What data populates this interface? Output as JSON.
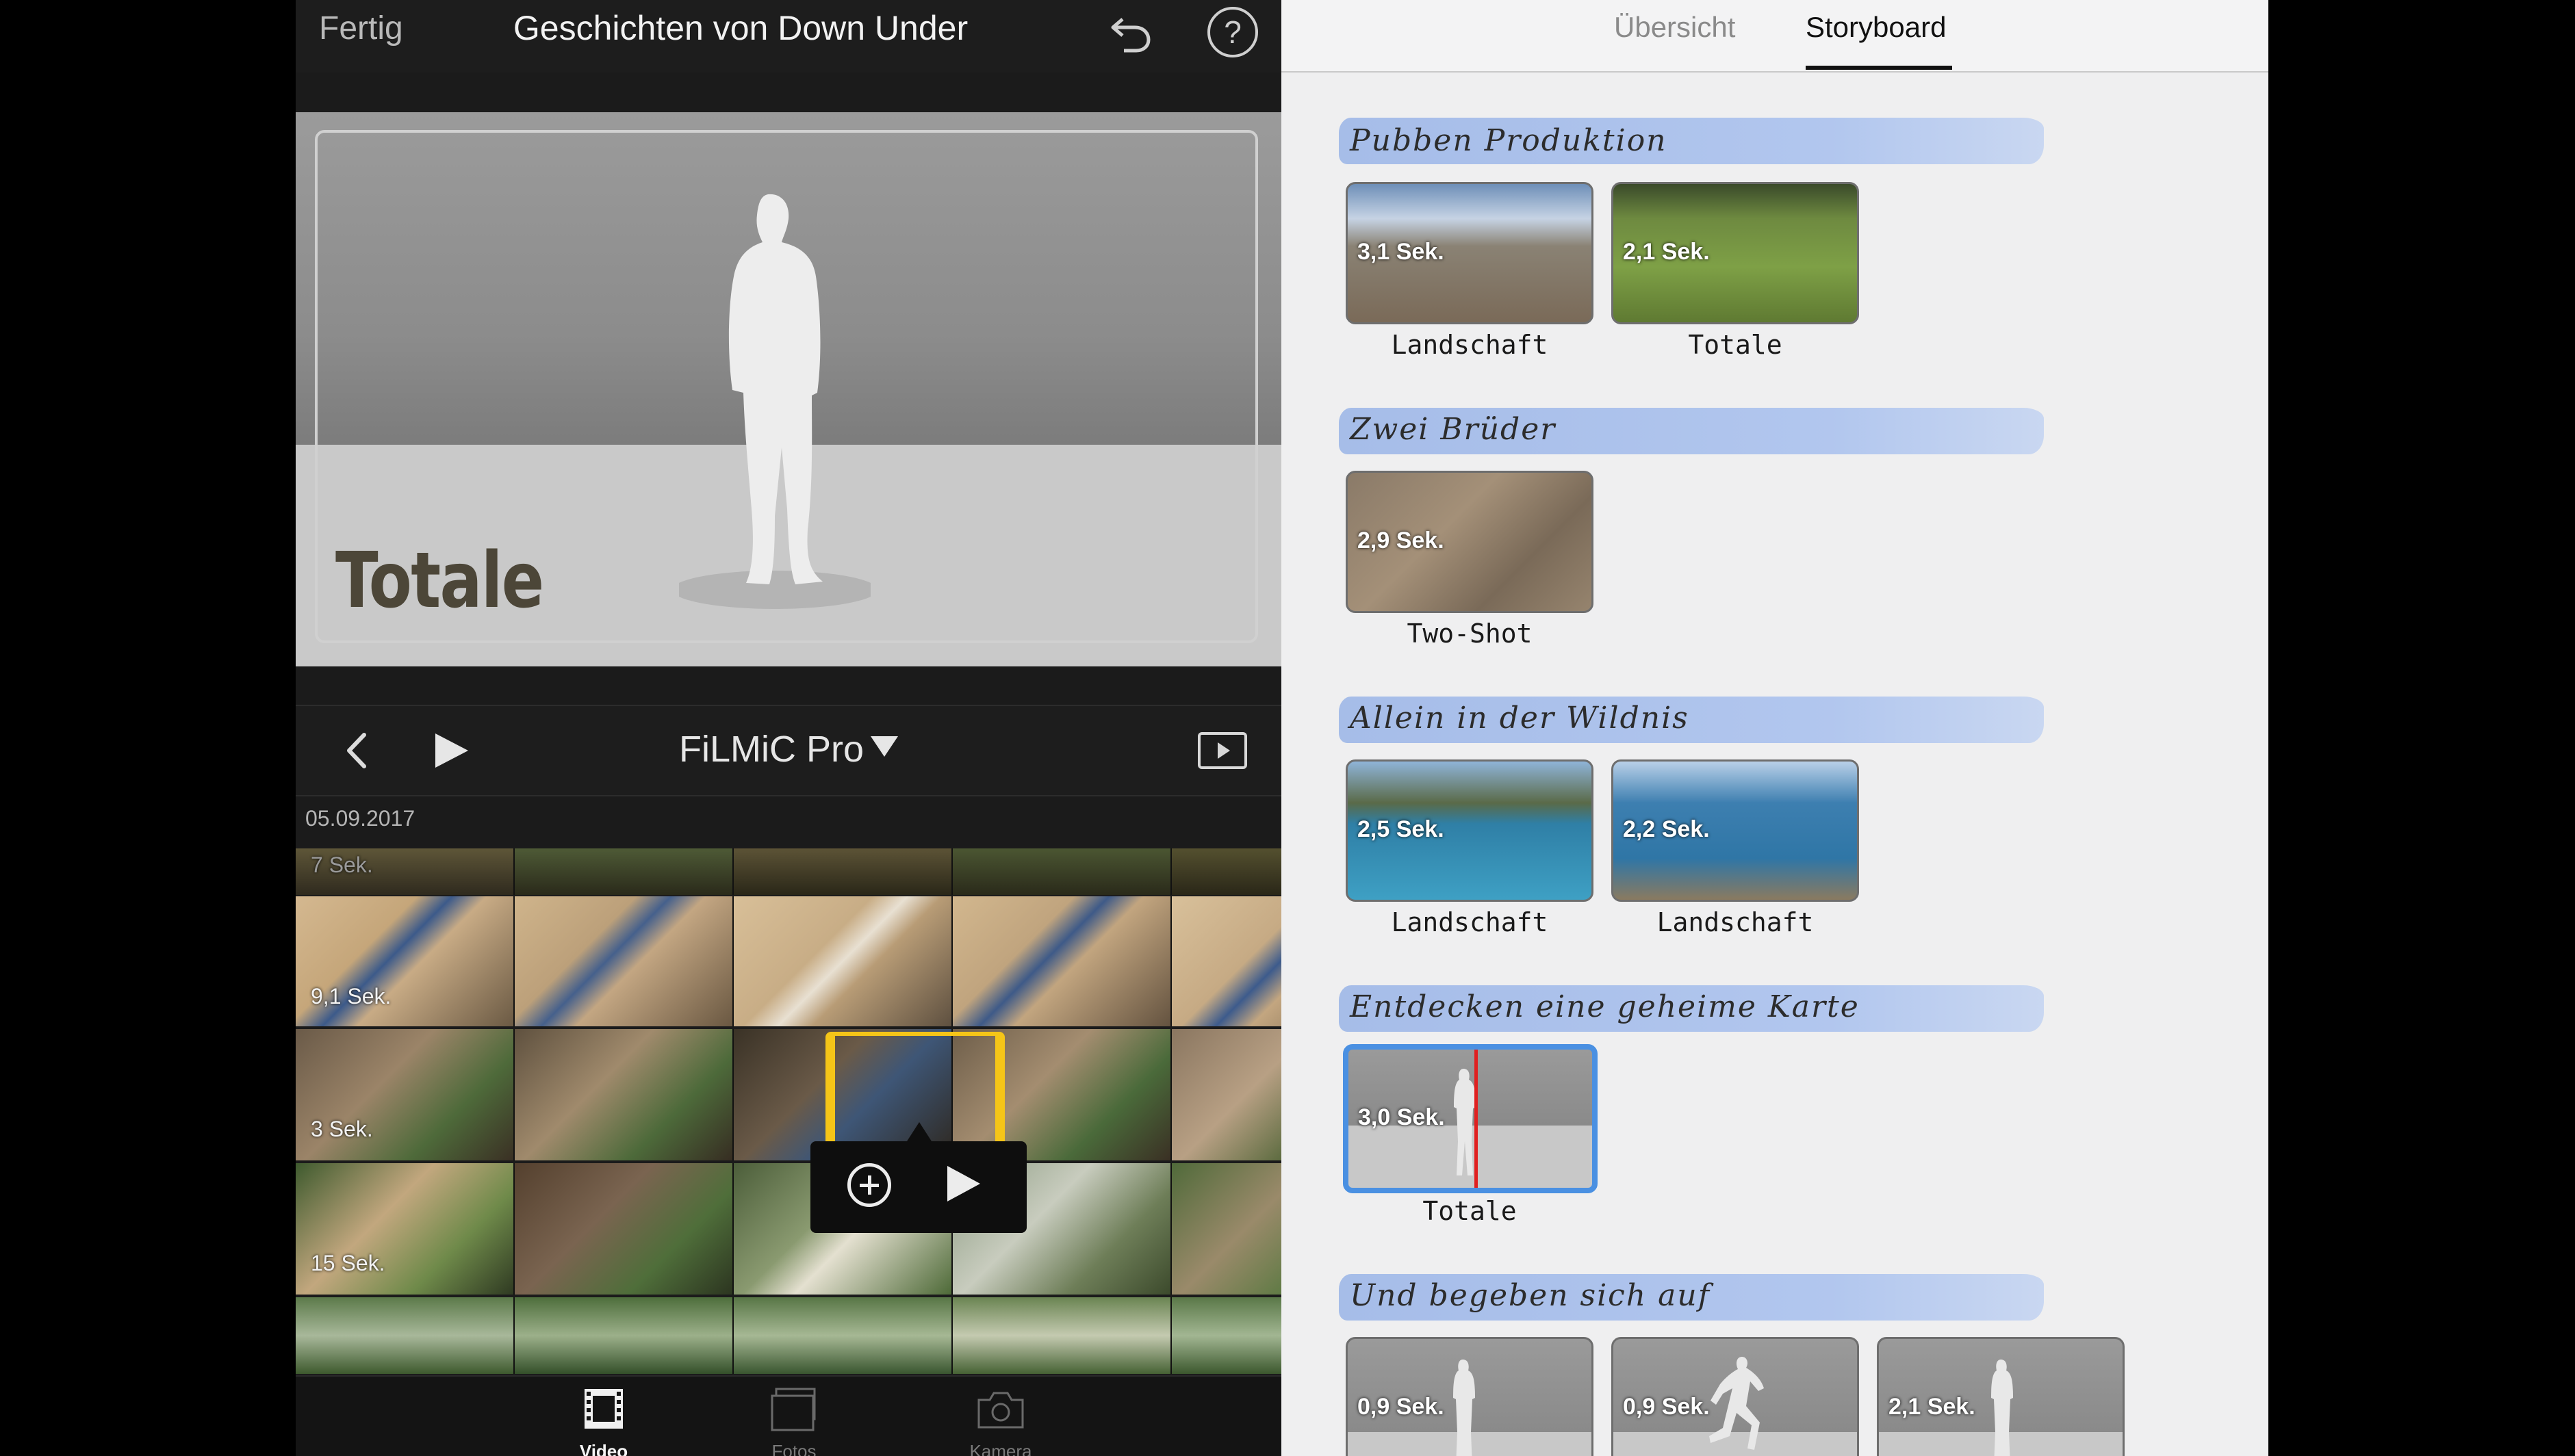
{
  "editor": {
    "done_label": "Fertig",
    "title": "Geschichten von Down Under",
    "help_label": "?",
    "preview_label": "Totale",
    "source_label": "FiLMiC Pro",
    "date_label": "05.09.2017",
    "clip_durations": [
      "7 Sek.",
      "9,1 Sek.",
      "3 Sek.",
      "15 Sek."
    ],
    "tabs": [
      {
        "label": "Video",
        "active": true
      },
      {
        "label": "Fotos",
        "active": false
      },
      {
        "label": "Kamera",
        "active": false
      }
    ],
    "icons": [
      "undo-icon",
      "help-icon",
      "back-chevron-icon",
      "play-icon",
      "dropdown-caret-icon",
      "fullscreen-play-icon",
      "add-icon",
      "film-icon",
      "photos-icon",
      "camera-icon"
    ]
  },
  "storyboard": {
    "tabs": [
      {
        "label": "Übersicht",
        "active": false
      },
      {
        "label": "Storyboard",
        "active": true
      }
    ],
    "sections": [
      {
        "title": "Pubben Produktion",
        "clips": [
          {
            "duration": "3,1 Sek.",
            "caption": "Landschaft"
          },
          {
            "duration": "2,1 Sek.",
            "caption": "Totale"
          }
        ]
      },
      {
        "title": "Zwei Brüder",
        "clips": [
          {
            "duration": "2,9 Sek.",
            "caption": "Two-Shot"
          }
        ]
      },
      {
        "title": "Allein in der Wildnis",
        "clips": [
          {
            "duration": "2,5 Sek.",
            "caption": "Landschaft"
          },
          {
            "duration": "2,2 Sek.",
            "caption": "Landschaft"
          }
        ]
      },
      {
        "title": "Entdecken eine geheime Karte",
        "clips": [
          {
            "duration": "3,0 Sek.",
            "caption": "Totale",
            "selected": true
          }
        ]
      },
      {
        "title": "Und begeben sich auf",
        "clips": [
          {
            "duration": "0,9 Sek.",
            "caption": ""
          },
          {
            "duration": "0,9 Sek.",
            "caption": ""
          },
          {
            "duration": "2,1 Sek.",
            "caption": ""
          }
        ]
      }
    ]
  },
  "colors": {
    "accent_blue": "#4a90e2",
    "selection_yellow": "#f5c518",
    "playhead_red": "#e02020"
  }
}
